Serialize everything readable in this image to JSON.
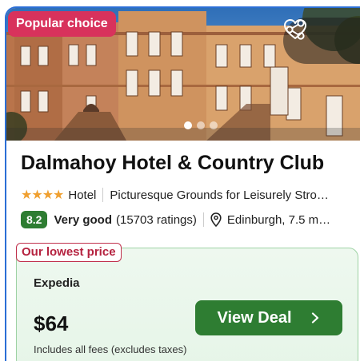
{
  "hero": {
    "badge": "Popular choice",
    "carousel_dots": 3,
    "active_dot": 0
  },
  "hotel": {
    "name": "Dalmahoy Hotel & Country Club",
    "star_rating": 4,
    "type": "Hotel",
    "tagline": "Picturesque Grounds for Leisurely Stro…",
    "score": "8.2",
    "rating_word": "Very good",
    "ratings_count": "(15703 ratings)",
    "location": "Edinburgh, 7.5 m…"
  },
  "deal": {
    "lowest_tag": "Our lowest price",
    "provider": "Expedia",
    "price": "$64",
    "fees_note": "Includes all fees (excludes taxes)",
    "cta": "View Deal"
  },
  "colors": {
    "accent_border": "#2b6fd6",
    "badge_pink": "#d8325c",
    "score_green": "#2e7d32",
    "star": "#f0a030",
    "price_box_bg": "#e6f5e8"
  }
}
